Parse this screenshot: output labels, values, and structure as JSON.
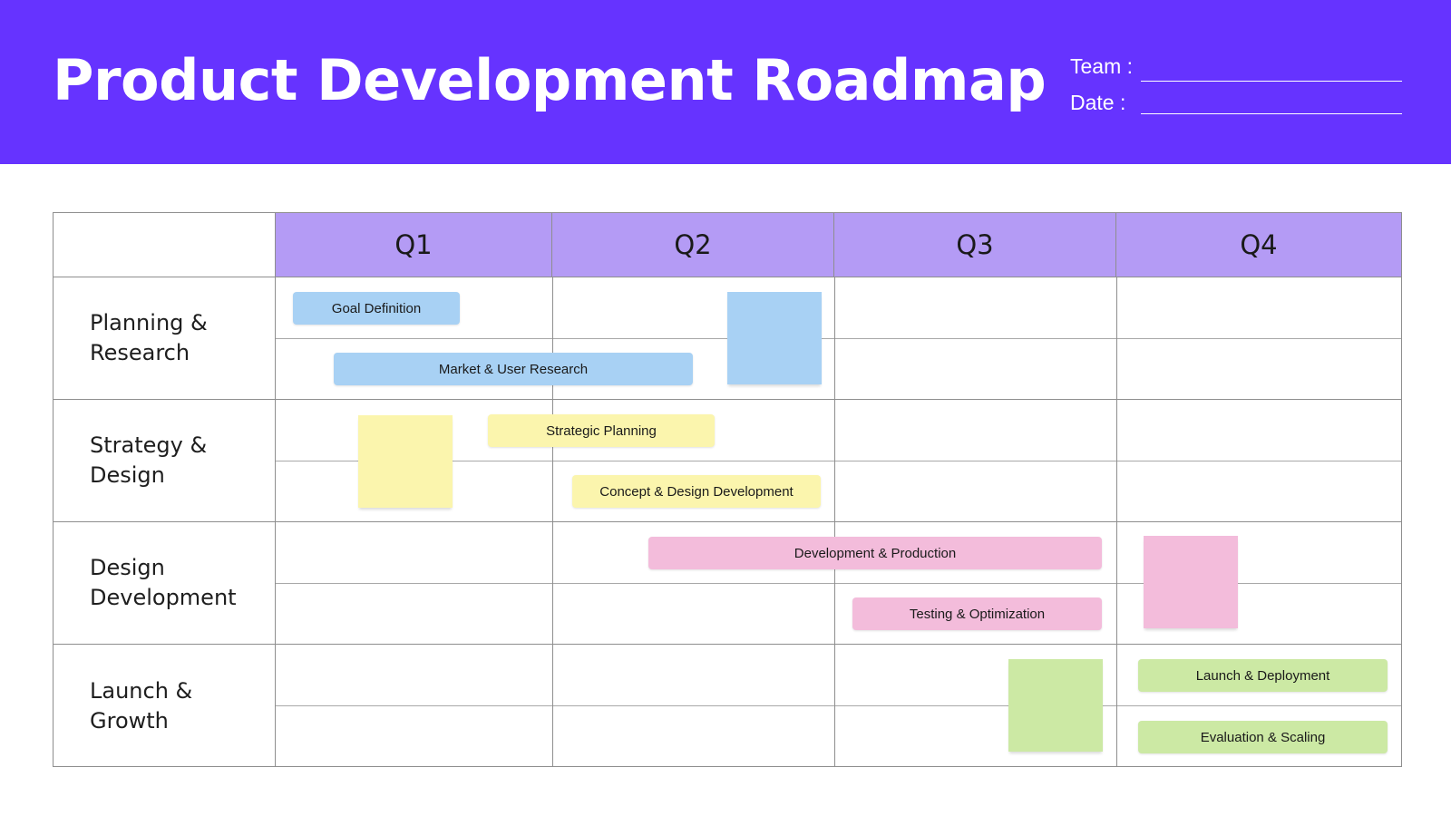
{
  "header": {
    "title": "Product Development Roadmap",
    "team_label": "Team :",
    "date_label": "Date :",
    "team_value": "",
    "date_value": ""
  },
  "quarters": [
    "Q1",
    "Q2",
    "Q3",
    "Q4"
  ],
  "rows": [
    {
      "label": "Planning &\nResearch"
    },
    {
      "label": "Strategy &\nDesign"
    },
    {
      "label": "Design\nDevelopment"
    },
    {
      "label": "Launch &\nGrowth"
    }
  ],
  "tasks": [
    {
      "label": "Goal Definition",
      "color": "#a8d1f4"
    },
    {
      "label": "Market & User Research",
      "color": "#a8d1f4"
    },
    {
      "label": "Strategic Planning",
      "color": "#fbf5ad"
    },
    {
      "label": "Concept & Design Development",
      "color": "#fbf5ad"
    },
    {
      "label": "Development & Production",
      "color": "#f3bcdb"
    },
    {
      "label": "Testing & Optimization",
      "color": "#f3bcdb"
    },
    {
      "label": "Launch & Deployment",
      "color": "#cce9a4"
    },
    {
      "label": "Evaluation & Scaling",
      "color": "#cce9a4"
    }
  ],
  "sticky_notes": [
    {
      "color": "#a8d1f4"
    },
    {
      "color": "#fbf5ad"
    },
    {
      "color": "#f3bcdb"
    },
    {
      "color": "#cce9a4"
    }
  ],
  "colors": {
    "header_bg": "#6633ff",
    "quarter_header_bg": "#b49bf5",
    "grid_line": "#8e8e8e"
  }
}
